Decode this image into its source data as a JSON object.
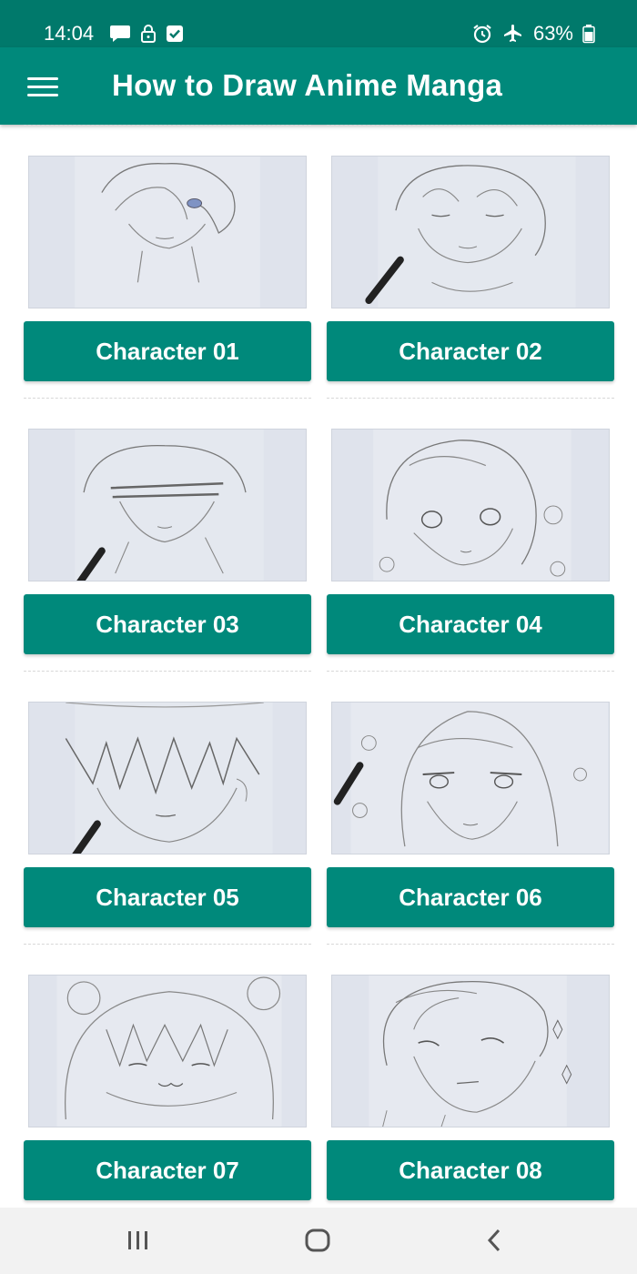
{
  "status_bar": {
    "time": "14:04",
    "left_icons": [
      "message-icon",
      "lock-icon",
      "checkbox-icon"
    ],
    "right_icons": [
      "alarm-icon",
      "airplane-icon"
    ],
    "battery": "63%"
  },
  "app_bar": {
    "menu_icon": "hamburger-menu-icon",
    "title": "How to Draw Anime Manga"
  },
  "characters": [
    {
      "label": "Character 01"
    },
    {
      "label": "Character 02"
    },
    {
      "label": "Character 03"
    },
    {
      "label": "Character 04"
    },
    {
      "label": "Character 05"
    },
    {
      "label": "Character 06"
    },
    {
      "label": "Character 07"
    },
    {
      "label": "Character 08"
    }
  ],
  "nav_bar": {
    "buttons": [
      "recent-apps-icon",
      "home-icon",
      "back-icon"
    ]
  },
  "colors": {
    "status_bar": "#00796b",
    "app_bar": "#00897b",
    "card_button": "#00897b",
    "nav_bar": "#f2f2f2"
  }
}
